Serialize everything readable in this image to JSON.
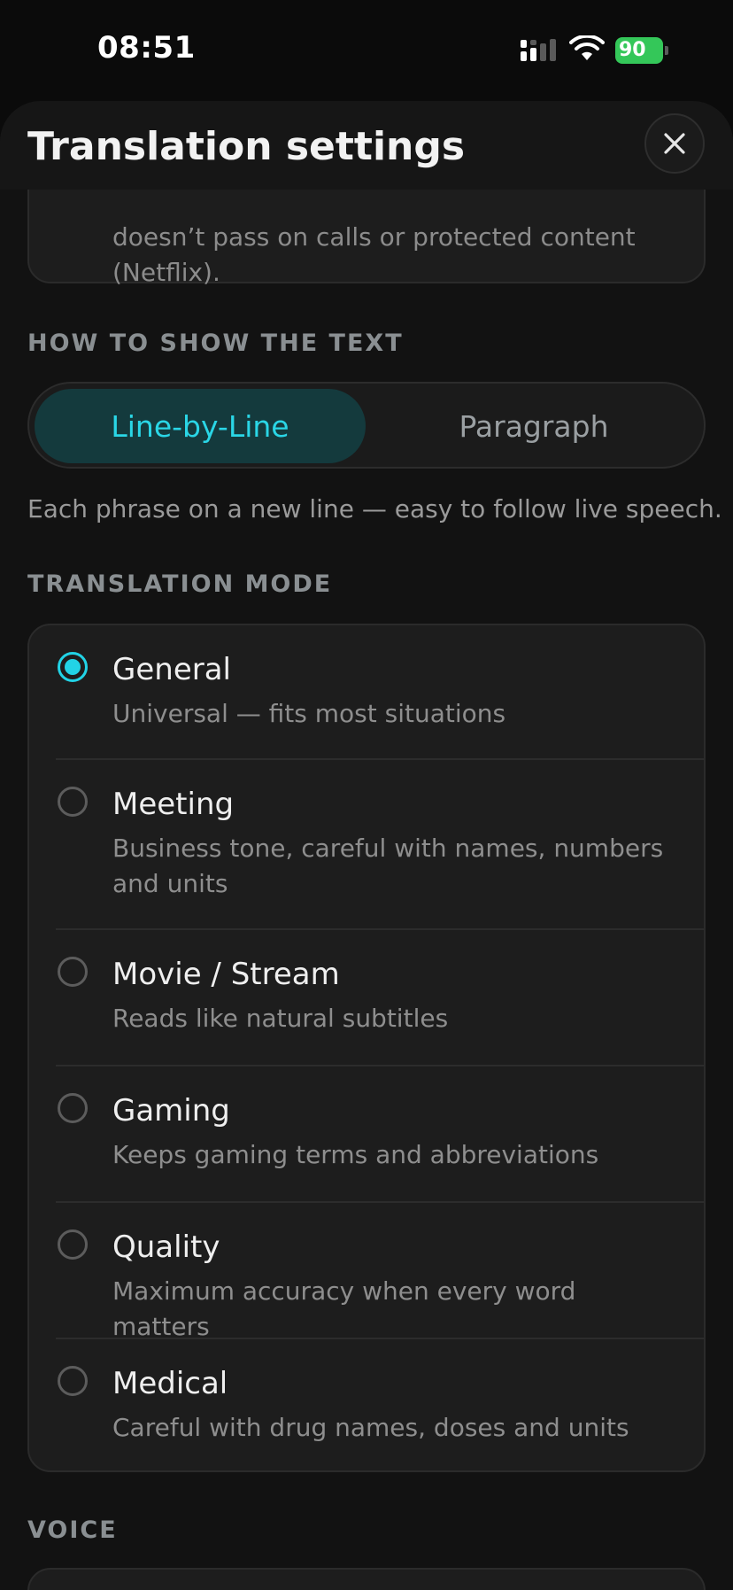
{
  "status_bar": {
    "time": "08:51",
    "battery_level": "90",
    "battery_color": "#34c759"
  },
  "header": {
    "title": "Translation settings",
    "close_icon": "close-icon"
  },
  "info_card": {
    "text_partial": "doesn’t pass on calls or protected content (Netflix)."
  },
  "display_section": {
    "label": "HOW TO SHOW THE TEXT",
    "options": [
      "Line-by-Line",
      "Paragraph"
    ],
    "selected": "Line-by-Line",
    "hint": "Each phrase on a new line — easy to follow live speech."
  },
  "mode_section": {
    "label": "TRANSLATION MODE",
    "selected": "General",
    "modes": [
      {
        "title": "General",
        "description": "Universal — fits most situations"
      },
      {
        "title": "Meeting",
        "description": "Business tone, careful with names, numbers and units"
      },
      {
        "title": "Movie / Stream",
        "description": "Reads like natural subtitles"
      },
      {
        "title": "Gaming",
        "description": "Keeps gaming terms and abbreviations"
      },
      {
        "title": "Quality",
        "description": "Maximum accuracy when every word matters"
      },
      {
        "title": "Medical",
        "description": "Careful with drug names, doses and units"
      }
    ]
  },
  "voice_section": {
    "label": "VOICE"
  },
  "colors": {
    "accent": "#22d3e6",
    "selected_segment_bg": "#143a3d",
    "background": "#121212"
  }
}
